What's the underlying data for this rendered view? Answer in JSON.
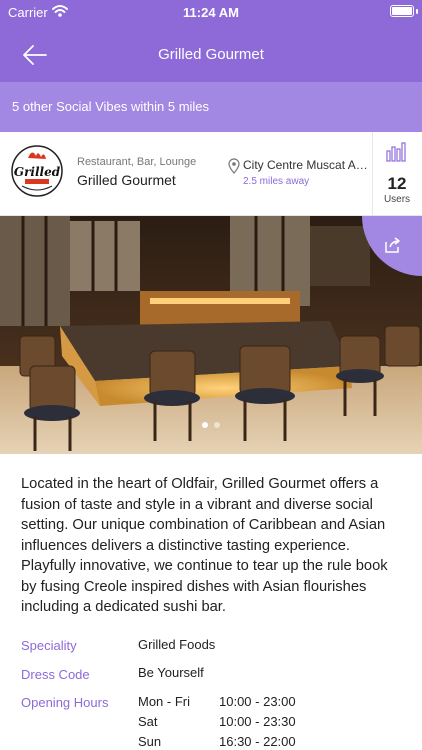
{
  "status_bar": {
    "carrier": "Carrier",
    "time": "11:24 AM"
  },
  "nav": {
    "title": "Grilled Gourmet"
  },
  "vibes_banner": "5 other Social Vibes within 5 miles",
  "venue": {
    "categories": "Restaurant, Bar, Lounge",
    "name": "Grilled Gourmet",
    "address": "City Centre Muscat Al, Oman",
    "distance": "2.5 miles away",
    "users_count": "12",
    "users_label": "Users",
    "logo_text": "Grilled"
  },
  "photo": {
    "pages": 2,
    "current_page": 1
  },
  "description": "Located in the heart of Oldfair, Grilled Gourmet offers a fusion of taste and style in a vibrant and diverse social setting. Our unique combination of Caribbean and Asian influences delivers a distinctive tasting experience. Playfully innovative, we continue to tear up the rule book by fusing Creole inspired dishes with Asian flourishes including a dedicated sushi bar.",
  "details": {
    "speciality_label": "Speciality",
    "speciality_value": "Grilled Foods",
    "dress_code_label": "Dress Code",
    "dress_code_value": "Be Yourself",
    "opening_hours_label": "Opening Hours",
    "hours": [
      {
        "day": "Mon - Fri",
        "time": "10:00 - 23:00"
      },
      {
        "day": "Sat",
        "time": "10:00 - 23:30"
      },
      {
        "day": "Sun",
        "time": "16:30 - 22:00"
      }
    ]
  },
  "colors": {
    "accent": "#8d6ad8",
    "accent_light": "#a388e3"
  },
  "icons": [
    "wifi-icon",
    "battery-icon",
    "back-arrow-icon",
    "location-pin-icon",
    "bar-chart-icon",
    "share-icon"
  ]
}
